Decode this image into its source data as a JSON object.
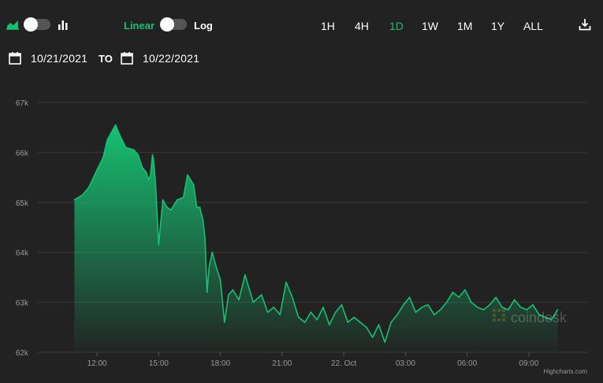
{
  "toolbar": {
    "area_icon": "area-chart-icon",
    "bar_icon": "bar-chart-icon",
    "linear_label": "Linear",
    "log_label": "Log",
    "ranges": [
      "1H",
      "4H",
      "1D",
      "1W",
      "1M",
      "1Y",
      "ALL"
    ],
    "active_range": "1D",
    "download_icon": "download-icon",
    "accent_color": "#16c172"
  },
  "dates": {
    "from": "10/21/2021",
    "to_label": "TO",
    "to": "10/22/2021",
    "calendar_icon": "calendar-icon"
  },
  "watermark": "coindesk",
  "credits": "Highcharts.com",
  "chart_data": {
    "type": "area",
    "title": "",
    "xlabel": "",
    "ylabel": "",
    "ylim": [
      62000,
      67000
    ],
    "y_ticks": [
      62000,
      63000,
      64000,
      65000,
      66000,
      67000
    ],
    "y_tick_labels": [
      "62k",
      "63k",
      "64k",
      "65k",
      "66k",
      "67k"
    ],
    "x_ticks": [
      12,
      15,
      18,
      21,
      24,
      27,
      30,
      33
    ],
    "x_tick_labels": [
      "12:00",
      "15:00",
      "18:00",
      "21:00",
      "22. Oct",
      "03:00",
      "06:00",
      "09:00"
    ],
    "xlim": [
      10.8,
      34.55
    ],
    "grid": true,
    "legend": "none",
    "series": [
      {
        "color": "#16c172",
        "x": [
          10.9,
          11.3,
          11.6,
          12.0,
          12.3,
          12.5,
          12.7,
          12.9,
          13.1,
          13.4,
          13.8,
          14.0,
          14.2,
          14.4,
          14.5,
          14.6,
          14.7,
          14.75,
          14.85,
          15.0,
          15.2,
          15.4,
          15.6,
          15.9,
          16.2,
          16.4,
          16.7,
          16.85,
          17.0,
          17.15,
          17.25,
          17.35,
          17.45,
          17.6,
          17.8,
          18.0,
          18.2,
          18.4,
          18.6,
          18.9,
          19.2,
          19.6,
          20.0,
          20.3,
          20.6,
          20.9,
          21.2,
          21.5,
          21.8,
          22.1,
          22.4,
          22.7,
          23.0,
          23.3,
          23.6,
          23.9,
          24.2,
          24.5,
          24.8,
          25.1,
          25.4,
          25.7,
          26.0,
          26.3,
          26.6,
          26.9,
          27.2,
          27.5,
          27.8,
          28.1,
          28.4,
          28.7,
          29.0,
          29.3,
          29.6,
          29.9,
          30.2,
          30.5,
          30.8,
          31.1,
          31.4,
          31.7,
          32.0,
          32.3,
          32.6,
          32.9,
          33.2,
          33.5,
          33.8,
          34.1,
          34.4
        ],
        "values": [
          65050,
          65150,
          65300,
          65650,
          65900,
          66250,
          66400,
          66550,
          66350,
          66100,
          66050,
          65950,
          65700,
          65600,
          65450,
          65550,
          65950,
          65850,
          65350,
          64150,
          65050,
          64900,
          64850,
          65050,
          65100,
          65550,
          65350,
          64900,
          64900,
          64650,
          64300,
          63200,
          63700,
          64000,
          63700,
          63450,
          62600,
          63150,
          63250,
          63050,
          63550,
          63000,
          63150,
          62800,
          62900,
          62750,
          63400,
          63100,
          62700,
          62600,
          62800,
          62650,
          62900,
          62550,
          62800,
          62950,
          62600,
          62700,
          62600,
          62500,
          62300,
          62550,
          62200,
          62600,
          62750,
          62950,
          63100,
          62800,
          62900,
          62950,
          62750,
          62850,
          63000,
          63200,
          63100,
          63250,
          63000,
          62900,
          62850,
          62950,
          63100,
          62900,
          62850,
          63050,
          62900,
          62850,
          62950,
          62750,
          62700,
          62650,
          62850
        ]
      }
    ]
  }
}
